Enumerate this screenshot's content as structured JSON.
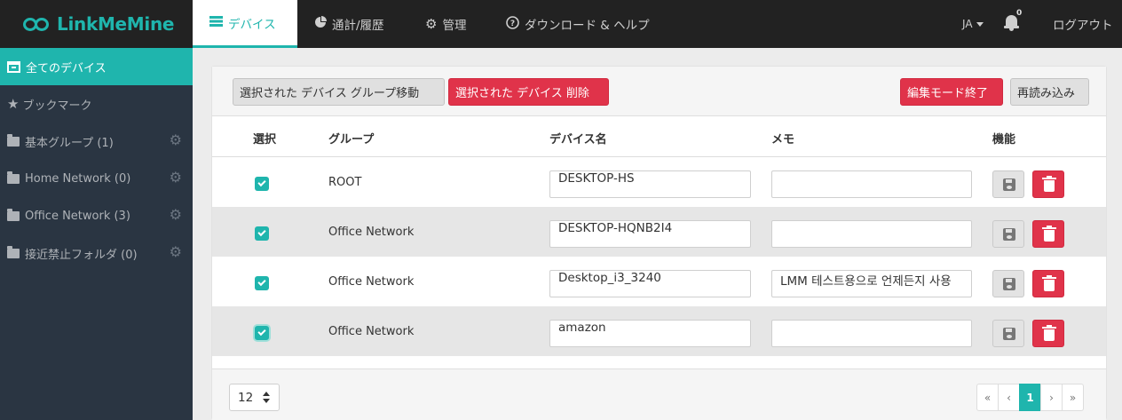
{
  "app": {
    "logo": "LinkMeMine"
  },
  "nav": {
    "tabs": [
      {
        "label": "デバイス",
        "icon": "server-icon",
        "active": true
      },
      {
        "label": "通計/履歴",
        "icon": "pie-chart-icon",
        "active": false
      },
      {
        "label": "管理",
        "icon": "gear-icon",
        "active": false
      },
      {
        "label": "ダウンロード & ヘルプ",
        "icon": "question-circle-icon",
        "active": false
      }
    ],
    "language": "JA",
    "notification_count": "0",
    "logout": "ログアウト"
  },
  "sidebar": {
    "items": [
      {
        "label": "全てのデバイス",
        "icon": "inbox-icon",
        "active": true
      },
      {
        "label": "ブックマーク",
        "icon": "star-icon"
      },
      {
        "label": "基本グループ (1)",
        "icon": "folder-icon",
        "settings": true
      },
      {
        "label": "Home Network (0)",
        "icon": "folder-icon",
        "settings": true
      },
      {
        "label": "Office Network (3)",
        "icon": "folder-icon",
        "settings": true
      },
      {
        "label": "接近禁止フォルダ (0)",
        "icon": "folder-icon",
        "settings": true
      }
    ]
  },
  "toolbar": {
    "move_label": "選択された デバイス グループ移動",
    "delete_label": "選択された デバイス 削除",
    "exit_edit_label": "編集モード終了",
    "reload_label": "再読み込み"
  },
  "table": {
    "headers": {
      "select": "選択",
      "group": "グループ",
      "device_name": "デバイス名",
      "memo": "メモ",
      "function": "機能"
    },
    "rows": [
      {
        "checked": true,
        "group": "ROOT",
        "device_name": "DESKTOP-HS",
        "memo": ""
      },
      {
        "checked": true,
        "group": "Office Network",
        "device_name": "DESKTOP-HQNB2I4",
        "memo": ""
      },
      {
        "checked": true,
        "group": "Office Network",
        "device_name": "Desktop_i3_3240",
        "memo": "LMM 테스트용으로 언제든지 사용"
      },
      {
        "checked": true,
        "group": "Office Network",
        "device_name": "amazon",
        "memo": ""
      }
    ]
  },
  "footer": {
    "per_page": "12",
    "pagination": {
      "first": "«",
      "prev": "‹",
      "current": "1",
      "next": "›",
      "last": "»"
    }
  },
  "colors": {
    "accent": "#1fb5ad",
    "danger": "#e0334a",
    "topbar": "#222222",
    "sidebar": "#2a3542"
  }
}
